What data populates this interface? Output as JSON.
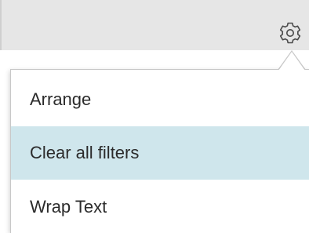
{
  "toolbar": {
    "settings_icon": "gear-icon"
  },
  "menu": {
    "items": [
      {
        "label": "Arrange",
        "selected": false
      },
      {
        "label": "Clear all filters",
        "selected": true
      },
      {
        "label": "Wrap Text",
        "selected": false
      }
    ]
  },
  "colors": {
    "toolbar_bg": "#e6e6e6",
    "highlight_bg": "#cfe6ec",
    "text": "#2b2b2b",
    "menu_border": "#c8c8c8"
  }
}
